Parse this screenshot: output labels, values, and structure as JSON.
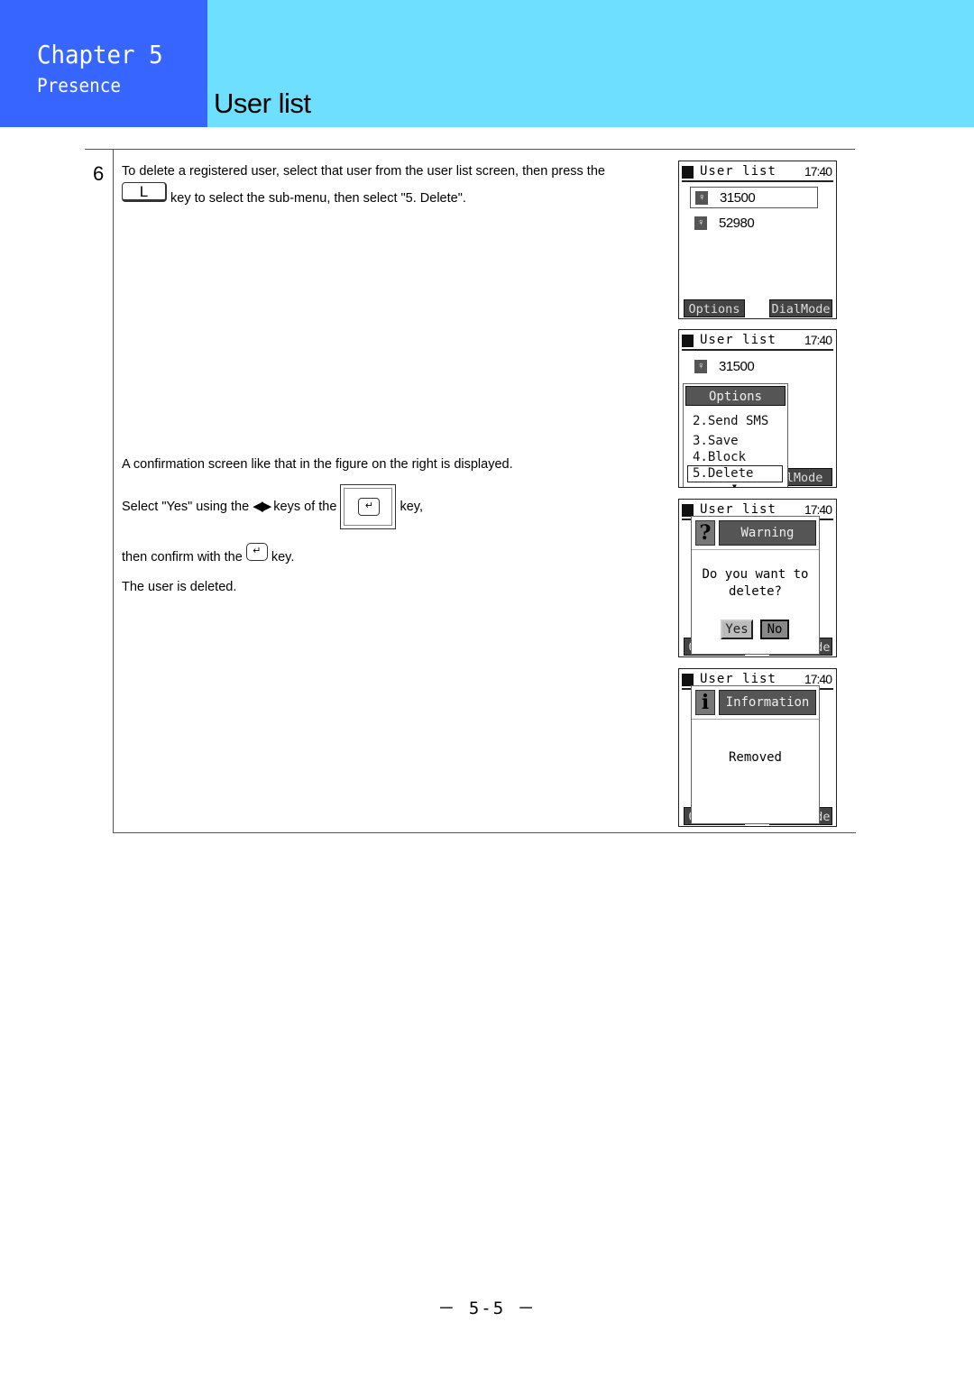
{
  "header": {
    "chapter": "Chapter 5",
    "section": "Presence",
    "title": "User list",
    "colors": {
      "chapter_bg": "#3665ff",
      "title_bg": "#6fdfff"
    }
  },
  "step": {
    "number": "6",
    "intro_line1": "To delete a registered user, select that user from the user list screen, then press the",
    "intro_key": "L",
    "intro_line2": "key to select the sub-menu, then select \"5. Delete\".",
    "confirm_text": "A confirmation screen like that in the figure on the right is displayed.",
    "select_pre": "Select \"Yes\" using the",
    "select_arrows": "◀▶",
    "select_mid": "keys of the",
    "select_post": "key,",
    "nav_key_glyph": "↵",
    "confirm_pre": "then confirm with the",
    "confirm_key_glyph": "↵",
    "confirm_post": "key.",
    "result": "The user is deleted."
  },
  "screens": [
    {
      "title": "User list",
      "time": "17:40",
      "rows": [
        {
          "number": "31500",
          "icon": "bulb-icon",
          "selected": true
        },
        {
          "number": "52980",
          "icon": "bulb-icon",
          "selected": false
        }
      ],
      "softkey_left": "Options",
      "softkey_right": "DialMode"
    },
    {
      "title": "User list",
      "time": "17:40",
      "rows": [
        {
          "number": "31500",
          "icon": "bulb-icon"
        }
      ],
      "menu": {
        "title": "Options",
        "items": [
          "2.Send SMS",
          "3.Save",
          "4.Block",
          "5.Delete"
        ],
        "selected": "5.Delete"
      },
      "softkey_right": "alMode"
    },
    {
      "title": "User list",
      "time": "17:40",
      "dialog": {
        "icon": "?",
        "title": "Warning",
        "message_line1": "Do you want to",
        "message_line2": "delete?",
        "yes": "Yes",
        "no": "No"
      },
      "softkey_left": "Options",
      "softkey_right": "DialMode"
    },
    {
      "title": "User list",
      "time": "17:40",
      "dialog": {
        "icon": "i",
        "title": "Information",
        "message_line1": "Removed"
      },
      "softkey_left": "Options",
      "softkey_right": "DialMode"
    }
  ],
  "footer": {
    "page": "－ 5-5 －"
  }
}
